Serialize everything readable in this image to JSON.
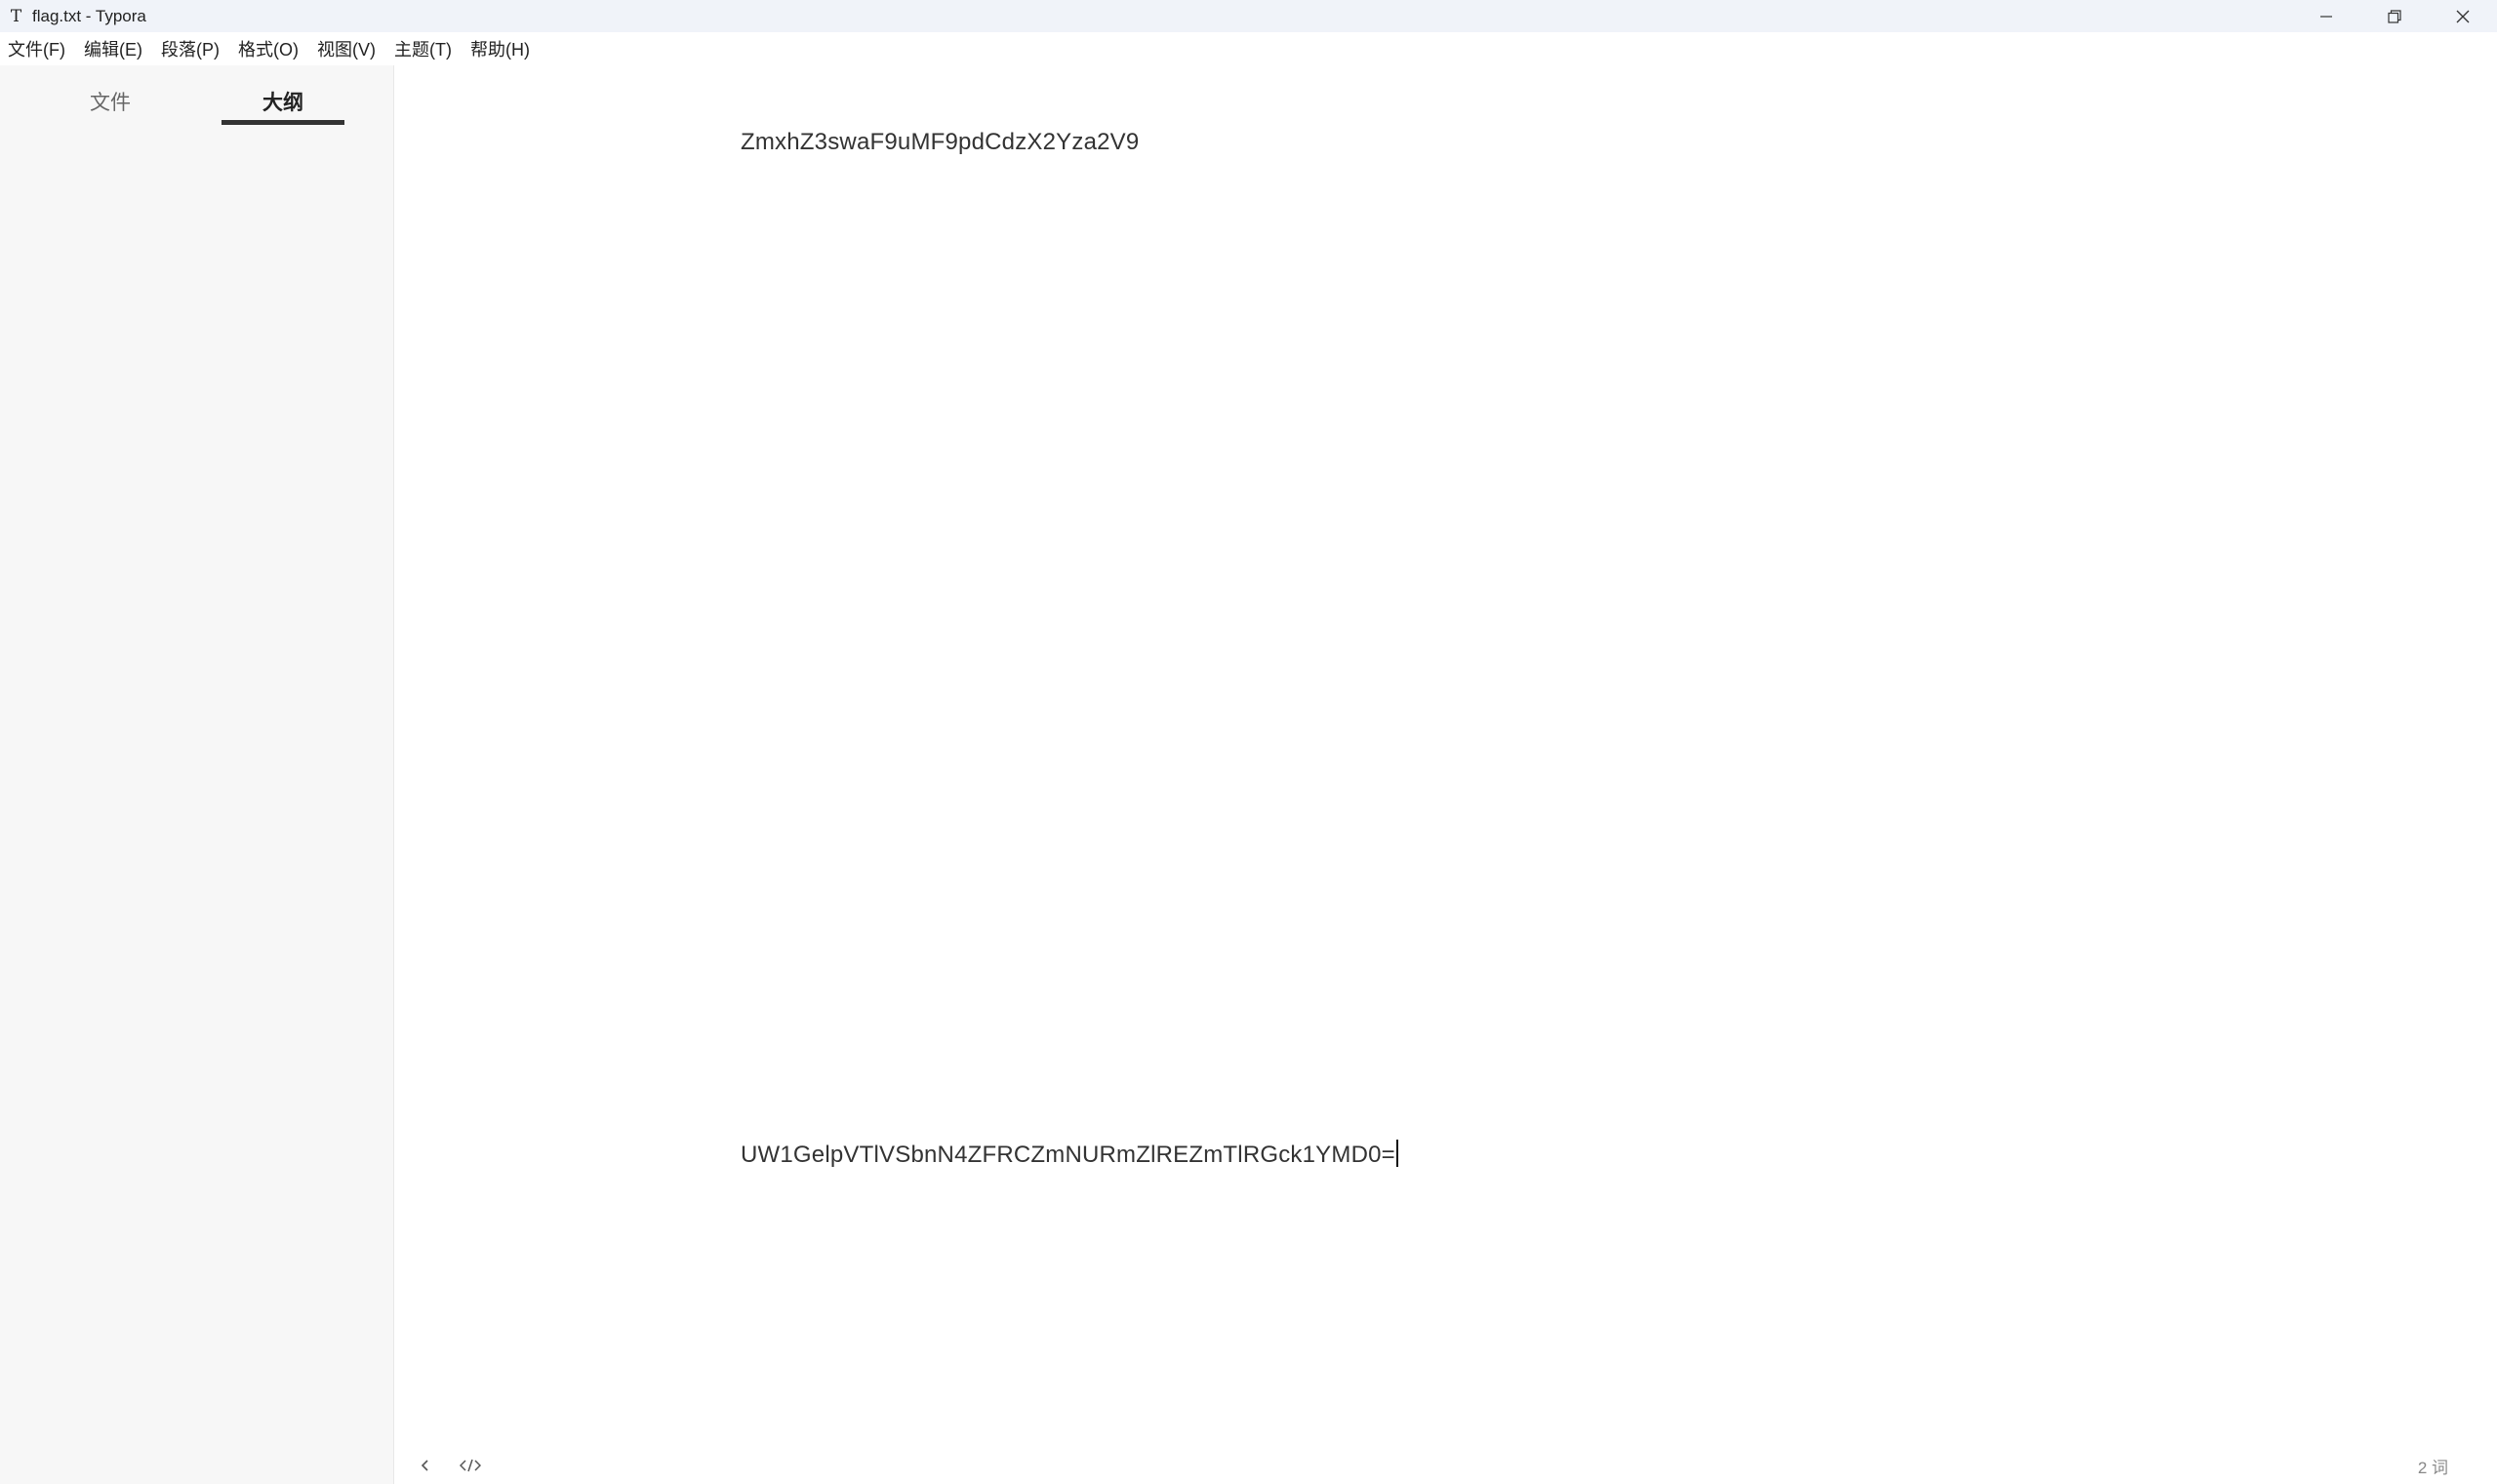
{
  "window": {
    "title": "flag.txt - Typora",
    "app_icon_glyph": "T"
  },
  "menu": [
    {
      "label": "文件(F)"
    },
    {
      "label": "编辑(E)"
    },
    {
      "label": "段落(P)"
    },
    {
      "label": "格式(O)"
    },
    {
      "label": "视图(V)"
    },
    {
      "label": "主题(T)"
    },
    {
      "label": "帮助(H)"
    }
  ],
  "sidebar": {
    "tabs": [
      {
        "label": "文件",
        "active": false
      },
      {
        "label": "大纲",
        "active": true
      }
    ]
  },
  "editor": {
    "lines": [
      "ZmxhZ3swaF9uMF9pdCdzX2Yza2V9",
      "UW1GelpVTlVSbnN4ZFRCZmNURmZlREZmTlRGck1YMD0="
    ]
  },
  "status": {
    "word_count": "2 词"
  },
  "icons": {
    "minimize": "minimize-icon",
    "restore": "restore-icon",
    "close": "close-icon",
    "sidebar_toggle": "chevron-left-icon",
    "source_mode": "code-icon"
  }
}
